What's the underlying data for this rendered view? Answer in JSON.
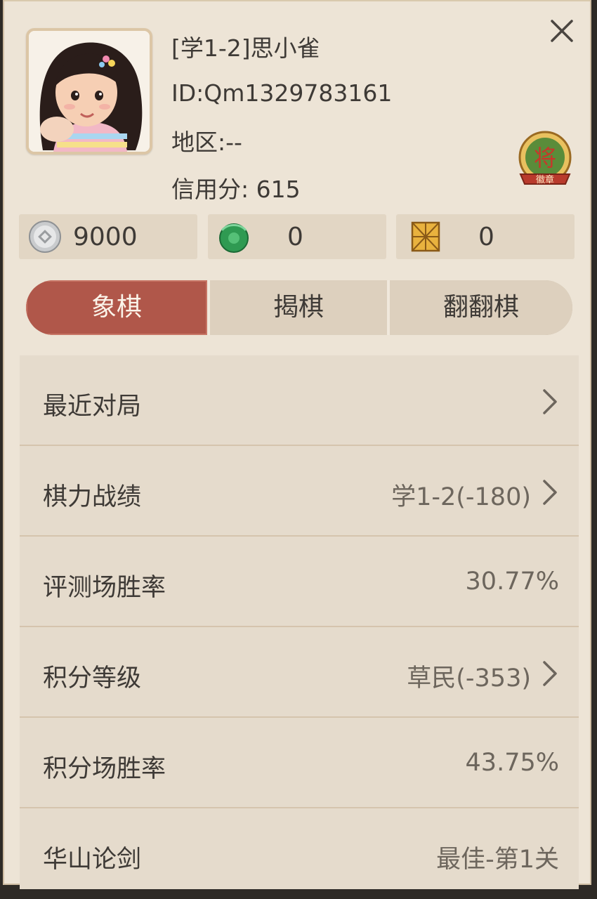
{
  "profile": {
    "name": "[学1-2]思小雀",
    "id": "ID:Qm1329783161",
    "region": "地区:--",
    "credit": "信用分: 615"
  },
  "medal": {
    "main": "将",
    "sub": "徽章"
  },
  "resources": [
    {
      "icon": "silver-coin-icon",
      "value": "9000"
    },
    {
      "icon": "jade-icon",
      "value": "0"
    },
    {
      "icon": "board-ticket-icon",
      "value": "0"
    }
  ],
  "tabs": [
    {
      "label": "象棋",
      "active": true
    },
    {
      "label": "揭棋",
      "active": false
    },
    {
      "label": "翻翻棋",
      "active": false
    }
  ],
  "rows": [
    {
      "label": "最近对局",
      "value": "",
      "arrow": true
    },
    {
      "label": "棋力战绩",
      "value": "学1-2(-180)",
      "arrow": true
    },
    {
      "label": "评测场胜率",
      "value": "30.77%",
      "arrow": false
    },
    {
      "label": "积分等级",
      "value": "草民(-353)",
      "arrow": true
    },
    {
      "label": "积分场胜率",
      "value": "43.75%",
      "arrow": false
    },
    {
      "label": "华山论剑",
      "value": "最佳-第1关",
      "arrow": false
    }
  ],
  "colors": {
    "panel_bg": "#ede4d6",
    "active_tab": "#b0574a",
    "text": "#3e3a36",
    "value_text": "#6d665d"
  }
}
